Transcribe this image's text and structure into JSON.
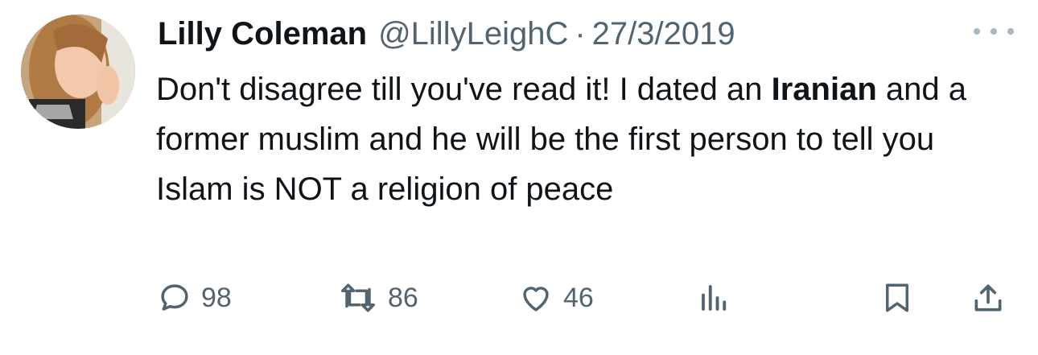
{
  "tweet": {
    "author_name": "Lilly Coleman",
    "handle": "@LillyLeighC",
    "separator": "·",
    "date": "27/3/2019",
    "text_part1": "Don't disagree till you've read it! I dated an ",
    "text_bold": "Iranian",
    "text_part2": " and a former muslim and he will be the first person to tell you Islam is NOT a religion of peace"
  },
  "actions": {
    "reply_count": "98",
    "retweet_count": "86",
    "like_count": "46"
  },
  "icons": [
    "avatar-image",
    "more-icon",
    "reply-icon",
    "retweet-icon",
    "like-icon",
    "views-icon",
    "bookmark-icon",
    "share-icon"
  ],
  "colors": {
    "text": "#0f1419",
    "secondary": "#536471",
    "background": "#ffffff"
  }
}
